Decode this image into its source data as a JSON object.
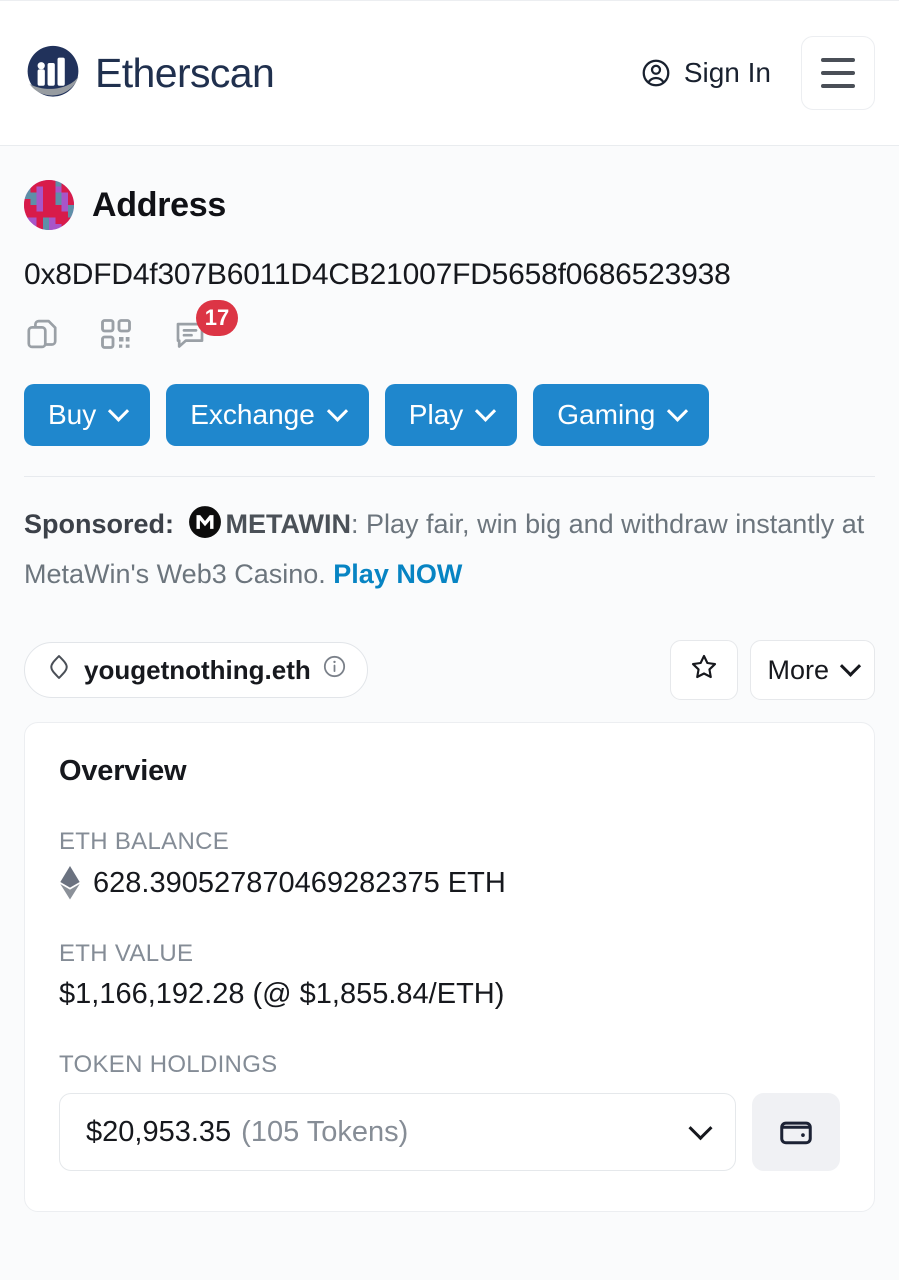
{
  "header": {
    "brand_name": "Etherscan",
    "signin_label": "Sign In",
    "menu_icon": "hamburger-menu-icon",
    "account_icon": "user-circle-icon",
    "logo_icon": "etherscan-logo-icon",
    "brand_color": "#21325b"
  },
  "address": {
    "page_title": "Address",
    "avatar_icon": "identicon-avatar",
    "hash": "0x8DFD4f307B6011D4CB21007FD5658f0686523938",
    "icons": [
      {
        "name": "copy-icon",
        "label": "Copy address"
      },
      {
        "name": "qr-code-icon",
        "label": "Show QR code"
      },
      {
        "name": "comment-icon",
        "label": "Comments"
      }
    ],
    "comment_count": "17",
    "badge_color": "#dc3545"
  },
  "action_buttons": {
    "accent_color": "#1f87cd",
    "items": [
      {
        "label": "Buy",
        "icon": "chevron-down-icon"
      },
      {
        "label": "Exchange",
        "icon": "chevron-down-icon"
      },
      {
        "label": "Play",
        "icon": "chevron-down-icon"
      },
      {
        "label": "Gaming",
        "icon": "chevron-down-icon"
      }
    ]
  },
  "sponsored": {
    "label": "Sponsored:",
    "advertiser_icon": "metawin-logo-icon",
    "advertiser": "METAWIN",
    "text_before": ": Play fair, win big and withdraw instantly at MetaWin's Web3 Casino.",
    "cta": "Play NOW",
    "cta_color": "#0784c3"
  },
  "ens": {
    "icon": "ens-diamond-icon",
    "name": "yougetnothing.eth",
    "info_icon": "info-circle-icon",
    "favorite_icon": "star-icon",
    "more_label": "More",
    "more_icon": "chevron-down-icon"
  },
  "overview": {
    "title": "Overview",
    "eth_balance_label": "ETH BALANCE",
    "eth_balance_icon": "ethereum-diamond-icon",
    "eth_balance_value": "628.390527870469282375 ETH",
    "eth_value_label": "ETH VALUE",
    "eth_value_value": "$1,166,192.28 (@ $1,855.84/ETH)",
    "token_holdings_label": "TOKEN HOLDINGS",
    "token_holdings_amount": "$20,953.35",
    "token_holdings_count": "(105 Tokens)",
    "token_dropdown_icon": "chevron-down-icon",
    "wallet_icon": "wallet-icon"
  }
}
